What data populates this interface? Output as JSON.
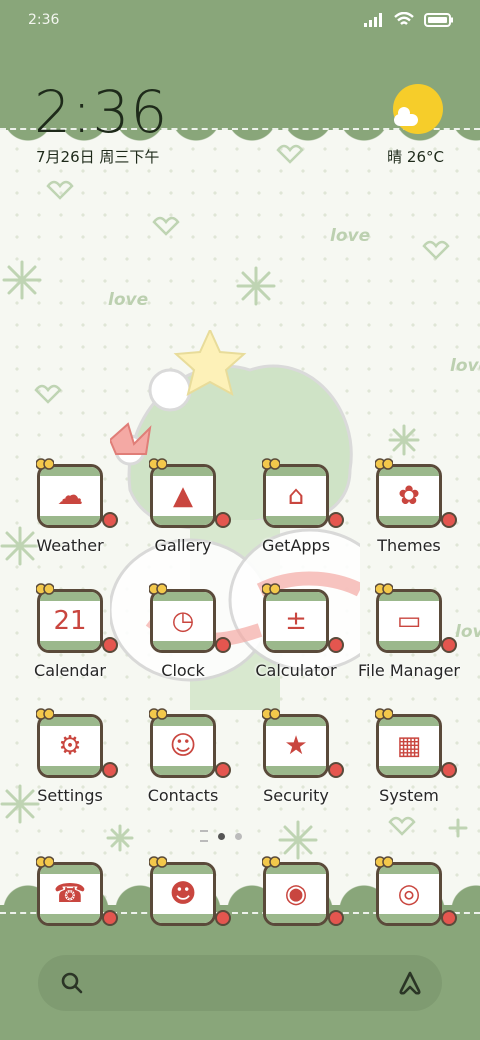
{
  "status_bar": {
    "time": "2:36"
  },
  "clock_widget": {
    "time": "2:36",
    "date": "7月26日 周三下午",
    "weather": "晴 26°C"
  },
  "background_words": [
    "love",
    "love",
    "love",
    "love"
  ],
  "apps": [
    {
      "label": "Weather",
      "icon": "weather-icon",
      "glyph": "☁"
    },
    {
      "label": "Gallery",
      "icon": "gallery-icon",
      "glyph": "▲"
    },
    {
      "label": "GetApps",
      "icon": "getapps-icon",
      "glyph": "⌂"
    },
    {
      "label": "Themes",
      "icon": "themes-icon",
      "glyph": "✿"
    },
    {
      "label": "Calendar",
      "icon": "calendar-icon",
      "glyph": "21"
    },
    {
      "label": "Clock",
      "icon": "clock-icon",
      "glyph": "◷"
    },
    {
      "label": "Calculator",
      "icon": "calculator-icon",
      "glyph": "±"
    },
    {
      "label": "File Manager",
      "icon": "folder-icon",
      "glyph": "▭"
    },
    {
      "label": "Settings",
      "icon": "settings-icon",
      "glyph": "⚙"
    },
    {
      "label": "Contacts",
      "icon": "contacts-icon",
      "glyph": "☺"
    },
    {
      "label": "Security",
      "icon": "security-icon",
      "glyph": "★"
    },
    {
      "label": "System",
      "icon": "system-folder-icon",
      "glyph": "▦"
    }
  ],
  "dock": [
    {
      "icon": "phone-icon",
      "glyph": "☎"
    },
    {
      "icon": "messages-icon",
      "glyph": "☻"
    },
    {
      "icon": "browser-icon",
      "glyph": "◉"
    },
    {
      "icon": "camera-icon",
      "glyph": "◎"
    }
  ],
  "colors": {
    "accent_green": "#89a67a",
    "sun_yellow": "#f6cd2a",
    "berry_red": "#e4564f"
  }
}
